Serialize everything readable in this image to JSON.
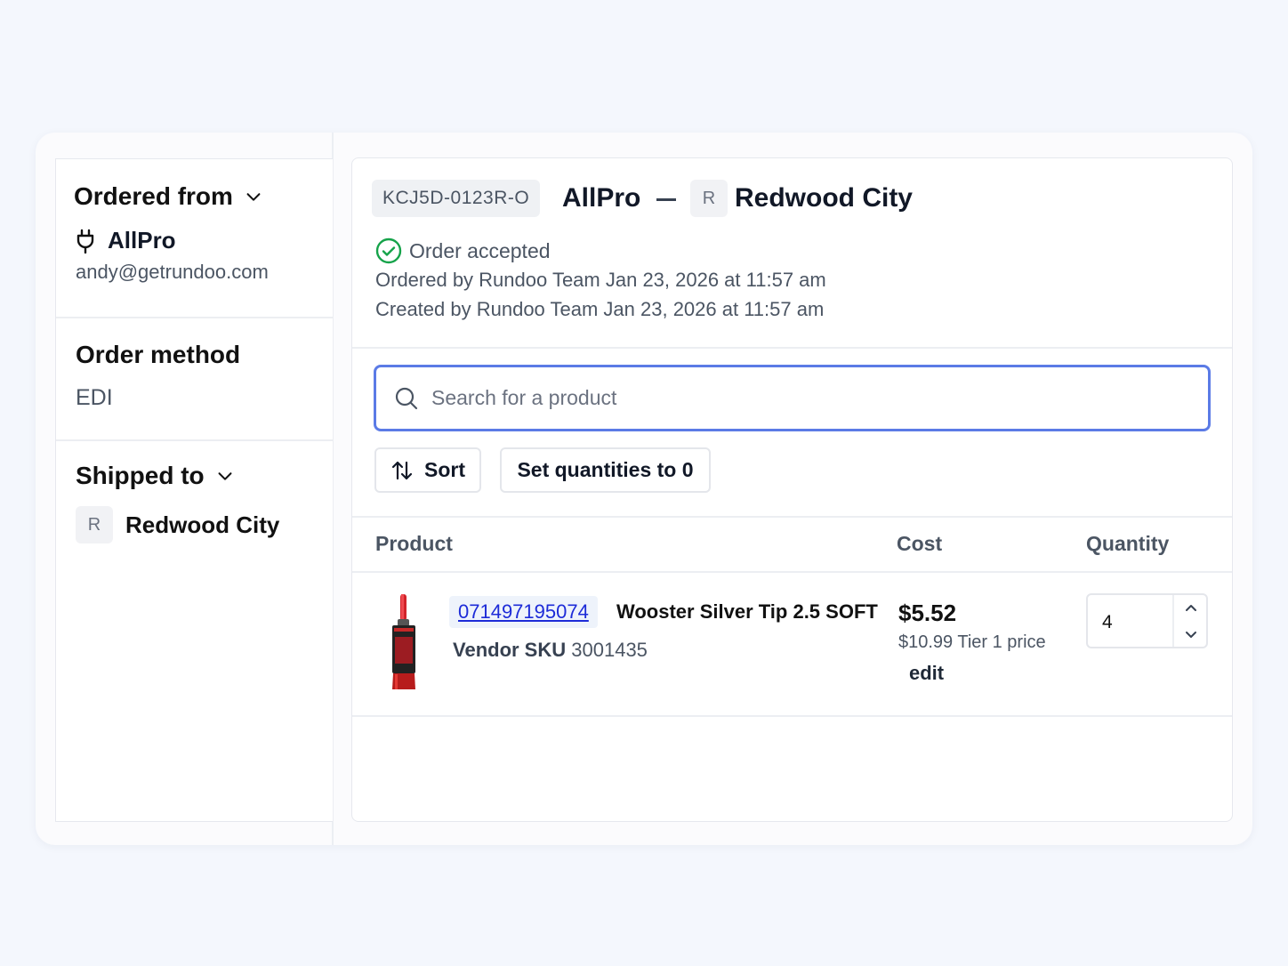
{
  "sidebar": {
    "ordered_from": {
      "heading": "Ordered from",
      "vendor_name": "AllPro",
      "email": "andy@getrundoo.com"
    },
    "order_method": {
      "heading": "Order method",
      "value": "EDI"
    },
    "shipped_to": {
      "heading": "Shipped to",
      "avatar_initial": "R",
      "store_name": "Redwood City"
    }
  },
  "order": {
    "id": "KCJ5D-0123R-O",
    "vendor": "AllPro",
    "store_initial": "R",
    "store": "Redwood City",
    "status": "Order accepted",
    "ordered_by": "Ordered by Rundoo Team Jan 23, 2026 at 11:57 am",
    "created_by": "Created by Rundoo Team Jan 23, 2026 at 11:57 am"
  },
  "search": {
    "placeholder": "Search for a product",
    "value": ""
  },
  "toolbar": {
    "sort_label": "Sort",
    "set_zero_label": "Set quantities to 0"
  },
  "table": {
    "headers": {
      "product": "Product",
      "cost": "Cost",
      "quantity": "Quantity"
    },
    "rows": [
      {
        "upc": "071497195074",
        "name": "Wooster Silver Tip 2.5 SOFT",
        "vendor_sku_label": "Vendor SKU",
        "vendor_sku": "3001435",
        "cost": "$5.52",
        "tier_price": "$10.99 Tier 1 price",
        "edit_label": "edit",
        "quantity": "4"
      }
    ]
  },
  "colors": {
    "accent": "#5b7be6",
    "status_green": "#16a34a",
    "link": "#1d2bd8"
  },
  "icons": {
    "dropdown": "chevron-down-icon",
    "vendor": "plug-icon",
    "status": "check-circle-icon",
    "search": "search-icon",
    "sort": "sort-arrows-icon"
  }
}
